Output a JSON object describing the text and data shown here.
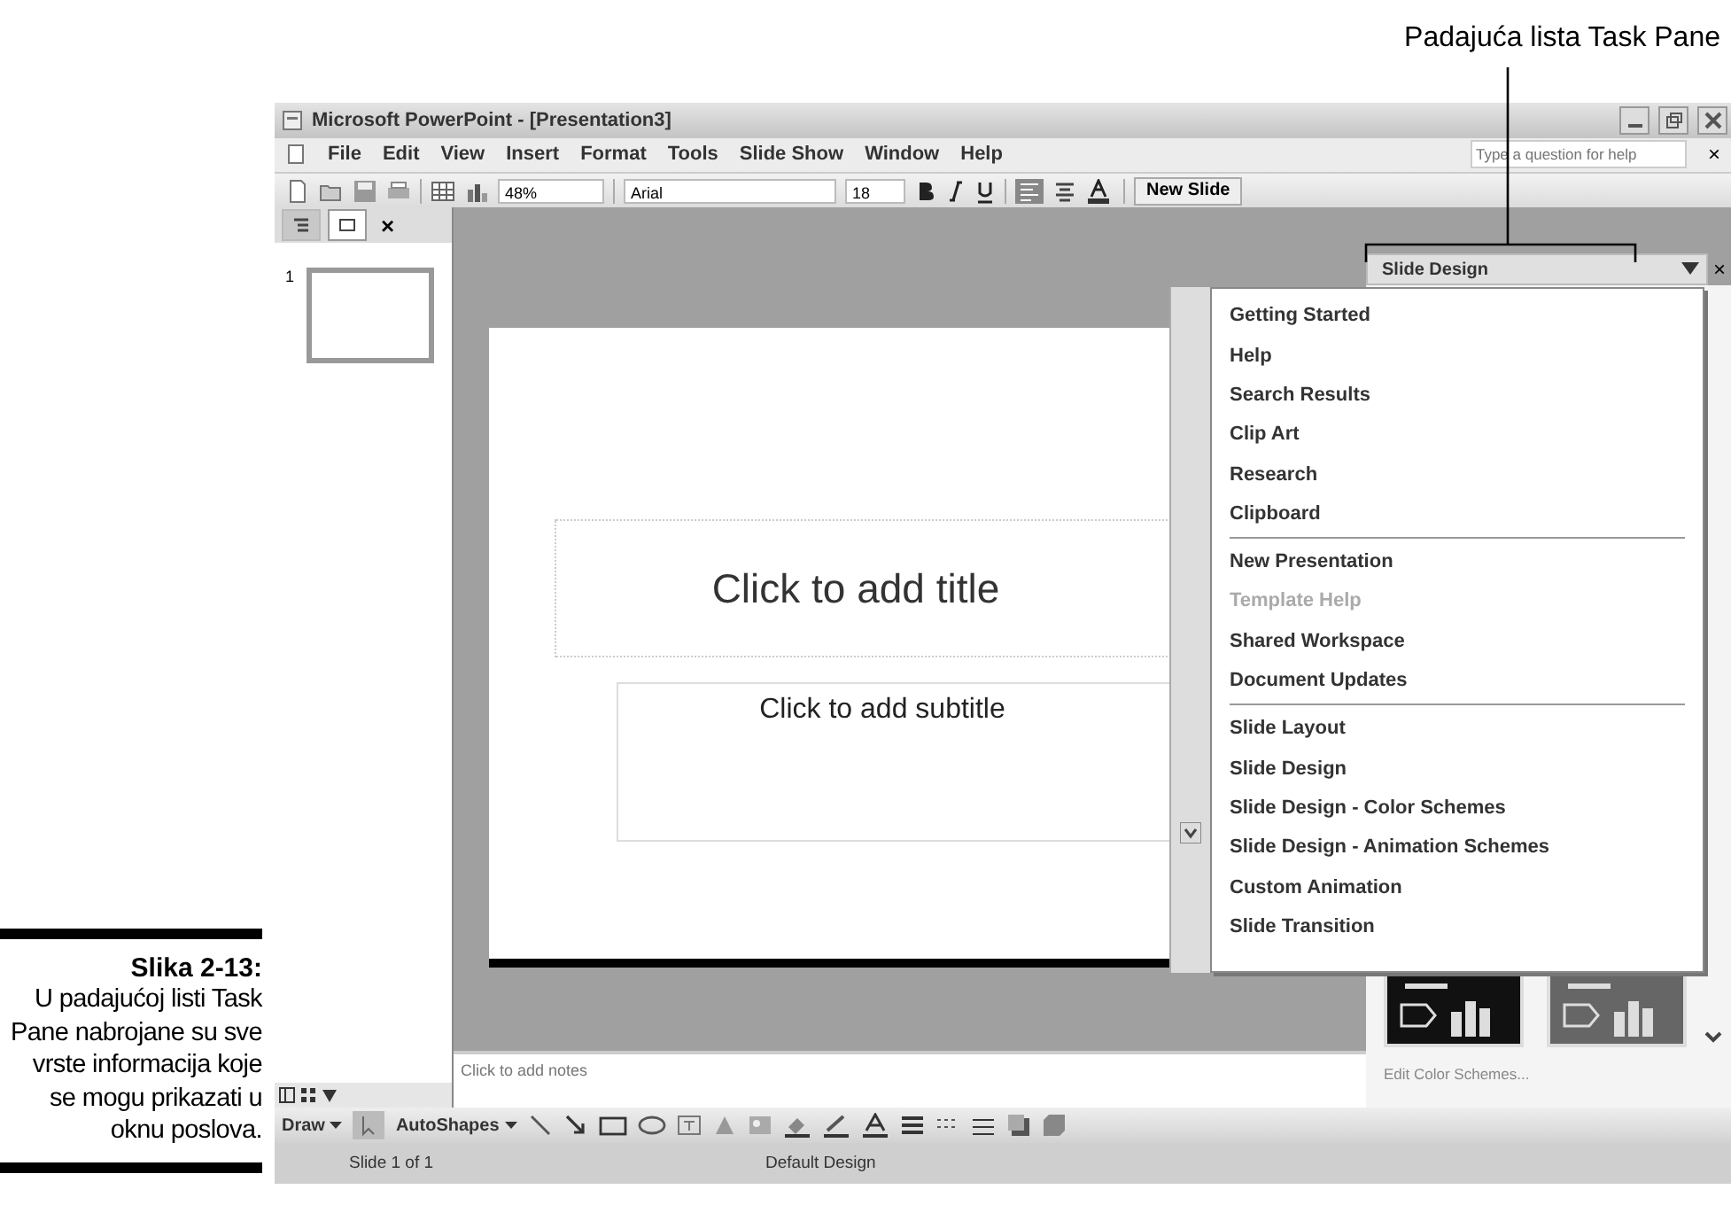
{
  "callout": {
    "label": "Padajuća lista Task Pane"
  },
  "caption": {
    "title": "Slika 2-13:",
    "text": "U padajućoj listi Task Pane nabrojane su sve vrste informacija koje se mogu prikazati u oknu poslova."
  },
  "window": {
    "title": "Microsoft PowerPoint - [Presentation3]"
  },
  "menu": [
    "File",
    "Edit",
    "View",
    "Insert",
    "Format",
    "Tools",
    "Slide Show",
    "Window",
    "Help"
  ],
  "help_box": {
    "placeholder": "Type a question for help",
    "close": "×"
  },
  "toolbar": {
    "zoom": "48%",
    "font": "Arial",
    "size": "18",
    "new_slide": "New Slide"
  },
  "outline_pane": {
    "close": "×",
    "tabs": [
      {
        "kind": "outline",
        "selected": false
      },
      {
        "kind": "slides",
        "selected": true
      }
    ],
    "slides": [
      {
        "number": "1",
        "selected": true
      }
    ]
  },
  "slide": {
    "title_placeholder": "Click to add title",
    "subtitle_placeholder": "Click to add subtitle"
  },
  "notes": {
    "placeholder": "Click to add notes"
  },
  "task_pane": {
    "title": "Slide Design",
    "close": "×",
    "footer_link": "Edit Color Schemes...",
    "thumbnails": [
      {
        "color": "#111111"
      },
      {
        "color": "#666666"
      }
    ]
  },
  "dropdown": {
    "groups": [
      [
        {
          "label": "Getting Started",
          "disabled": false
        },
        {
          "label": "Help",
          "disabled": false
        },
        {
          "label": "Search Results",
          "disabled": false
        },
        {
          "label": "Clip Art",
          "disabled": false
        },
        {
          "label": "Research",
          "disabled": false
        },
        {
          "label": "Clipboard",
          "disabled": false
        }
      ],
      [
        {
          "label": "New Presentation",
          "disabled": false
        },
        {
          "label": "Template Help",
          "disabled": true
        },
        {
          "label": "Shared Workspace",
          "disabled": false
        },
        {
          "label": "Document Updates",
          "disabled": false
        }
      ],
      [
        {
          "label": "Slide Layout",
          "disabled": false
        },
        {
          "label": "Slide Design",
          "disabled": false
        },
        {
          "label": "Slide Design - Color Schemes",
          "disabled": false
        },
        {
          "label": "Slide Design - Animation Schemes",
          "disabled": false
        },
        {
          "label": "Custom Animation",
          "disabled": false
        },
        {
          "label": "Slide Transition",
          "disabled": false
        }
      ]
    ]
  },
  "draw_toolbar": {
    "draw": "Draw",
    "autoshapes": "AutoShapes"
  },
  "status_bar": {
    "slide": "Slide 1 of 1",
    "design": "Default Design"
  }
}
